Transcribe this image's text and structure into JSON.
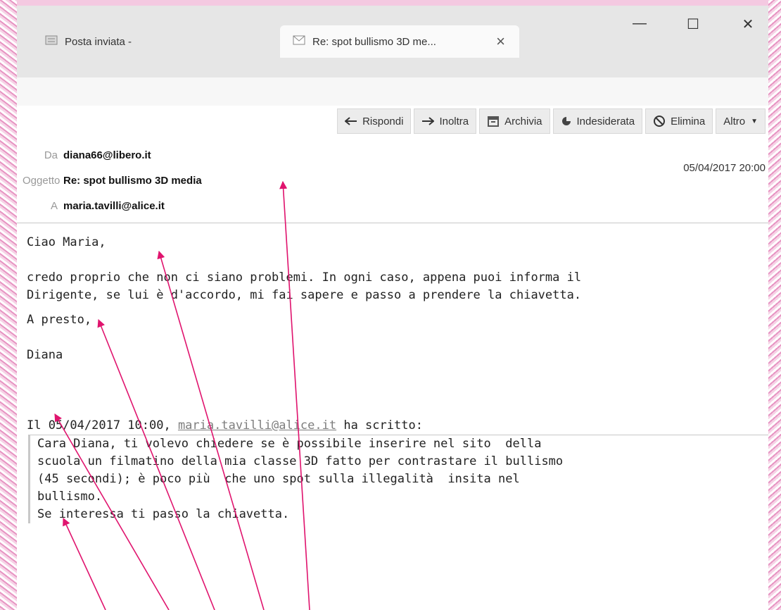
{
  "window": {
    "tabs": [
      {
        "label": "Posta inviata -",
        "icon": "folder-icon",
        "active": false
      },
      {
        "label": "Re: spot bullismo 3D me...",
        "icon": "envelope-icon",
        "active": true
      }
    ],
    "controls": {
      "minimize": "—",
      "maximize": "☐",
      "close": "✕"
    }
  },
  "toolbar": {
    "reply": "Rispondi",
    "forward": "Inoltra",
    "archive": "Archivia",
    "junk": "Indesiderata",
    "delete": "Elimina",
    "more": "Altro"
  },
  "header": {
    "from_label": "Da",
    "from": "diana66@libero.it",
    "subject_label": "Oggetto",
    "subject": "Re: spot bullismo 3D media",
    "to_label": "A",
    "to": "maria.tavilli@alice.it",
    "date": "05/04/2017 20:00"
  },
  "message": {
    "greeting": "Ciao Maria,",
    "line1": "credo proprio che non ci siano problemi. In ogni caso, appena puoi informa il",
    "line2": "Dirigente, se lui è d'accordo, mi fai sapere e passo a prendere la chiavetta.",
    "closing": "A presto,",
    "signature": "Diana",
    "quote_intro_prefix": "Il 05/04/2017 10:00, ",
    "quote_intro_email": "maria.tavilli@alice.it",
    "quote_intro_suffix": " ha scritto:",
    "quoted": [
      "Cara Diana, ti volevo chiedere se è possibile inserire nel sito  della",
      "scuola un filmatino della mia classe 3D fatto per contrastare il bullismo",
      "(45 secondi); è poco più  che uno spot sulla illegalità  insita nel",
      "bullismo.",
      "Se interessa ti passo la chiavetta."
    ]
  },
  "colors": {
    "annotation_arrow": "#e0146e"
  }
}
